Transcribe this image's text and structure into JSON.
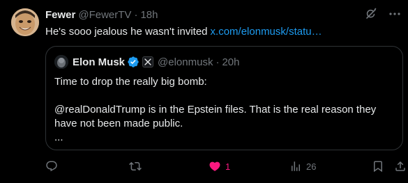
{
  "tweet": {
    "display_name": "Fewer",
    "handle": "@FewerTV",
    "separator": "·",
    "time": "18h",
    "text": "He's sooo jealous he wasn't invited",
    "link": "x.com/elonmusk/statu…",
    "avatar_icon": "cartoon-face-avatar"
  },
  "quote": {
    "display_name": "Elon Musk",
    "handle": "@elonmusk",
    "separator": "·",
    "time": "20h",
    "verified_icon": "verified-badge-icon",
    "affiliate_icon": "x-logo-icon",
    "lines": [
      "Time to drop the really big bomb:",
      "@realDonaldTrump is in the Epstein files. That is the real reason they have not been made public.",
      "..."
    ]
  },
  "actions": {
    "reply_count": "",
    "retweet_count": "",
    "like_count": "1",
    "views_count": "26"
  },
  "colors": {
    "background": "#000000",
    "text": "#e7e9ea",
    "muted": "#71767b",
    "link": "#1d9bf0",
    "like": "#f91880",
    "border": "#2f3336",
    "verified": "#1d9bf0"
  }
}
